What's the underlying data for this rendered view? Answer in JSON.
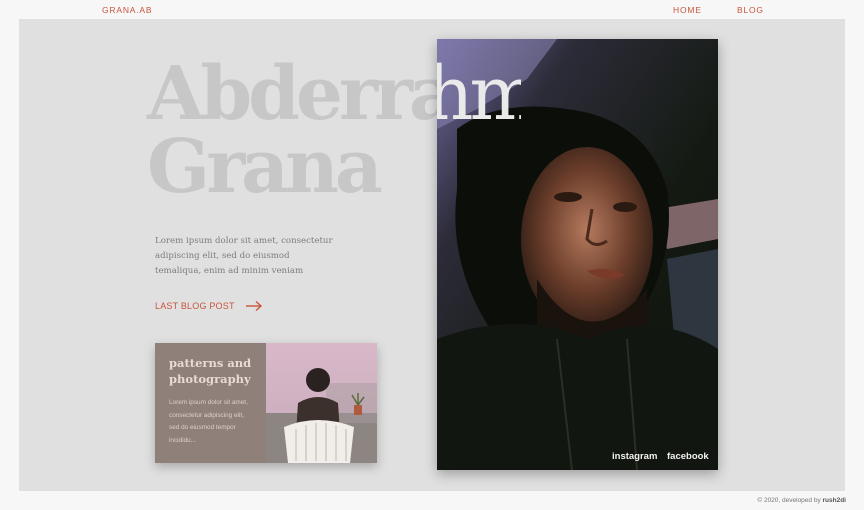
{
  "nav": {
    "brand": "GRANA.AB",
    "home": "HOME",
    "blog": "BLOG"
  },
  "hero": {
    "first_name": "Abderrahmane",
    "last_name": "Grana",
    "intro": "Lorem ipsum dolor sit amet, consectetur adipiscing elit, sed do eiusmod temaliqua, enim ad minim veniam",
    "cta_label": "LAST BLOG POST"
  },
  "card": {
    "title": "patterns and photography",
    "excerpt": "Lorem ipsum dolor sit amet, consectetur adipiscing elit, sed do eiusmod tempor incididu..."
  },
  "social": {
    "instagram": "instagram",
    "facebook": "facebook"
  },
  "footer": {
    "prefix": "© 2020, developed by",
    "author": "rush2di"
  },
  "colors": {
    "accent": "#c8553d",
    "panel": "#e0e0e0",
    "name_gray": "#c7c7c7"
  }
}
